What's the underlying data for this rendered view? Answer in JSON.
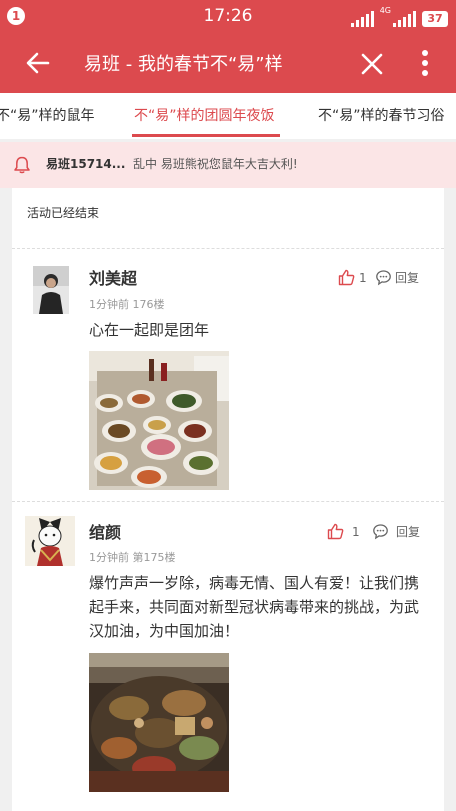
{
  "status_bar": {
    "notification_count": "1",
    "time": "17:26",
    "network_label": "4G",
    "battery": "37"
  },
  "app_bar": {
    "title": "易班 - 我的春节不“易”样",
    "back_icon": "arrow-left-icon",
    "close_icon": "close-icon",
    "more_icon": "more-vertical-icon"
  },
  "tabs": [
    {
      "label": "不“易”样的鼠年",
      "active": false
    },
    {
      "label": "不“易”样的团圆年夜饭",
      "active": true
    },
    {
      "label": "不“易”样的春节习俗",
      "active": false
    }
  ],
  "notice": {
    "icon": "bell-icon",
    "user": "易班15714...",
    "message": "乱中 易班熊祝您鼠年大吉大利!"
  },
  "activity_status": "活动已经结束",
  "posts": [
    {
      "username": "刘美超",
      "time": "1分钟前",
      "floor": "176楼",
      "likes": "1",
      "reply_label": "回复",
      "text": "心在一起即是团年"
    },
    {
      "username": "绾颜",
      "time": "1分钟前",
      "floor": "第175楼",
      "likes": "1",
      "reply_label": "回复",
      "text": "爆竹声声一岁除，病毒无情、国人有爱！让我们携起手来，共同面对新型冠状病毒带来的挑战，为武汉加油，为中国加油！"
    }
  ],
  "colors": {
    "brand": "#dc4a4e",
    "notice_bg": "#fbe5e6",
    "page_bg": "#f0f0f0"
  }
}
